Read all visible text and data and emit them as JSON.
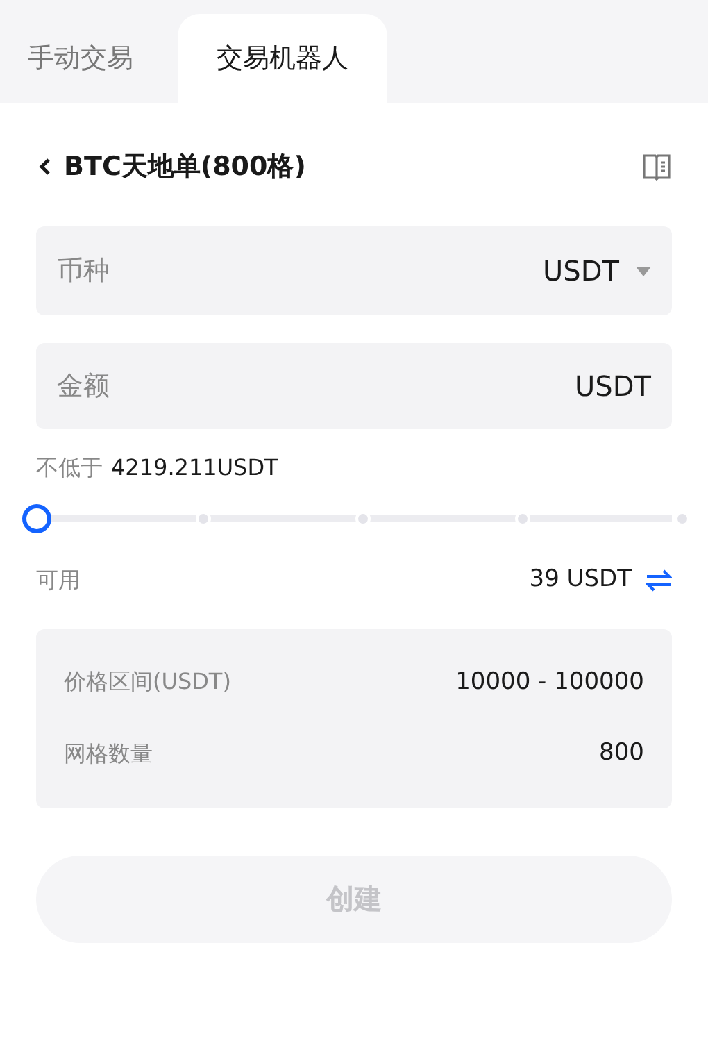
{
  "tabs": [
    {
      "label": "手动交易",
      "selected": false
    },
    {
      "label": "交易机器人",
      "selected": true
    }
  ],
  "header": {
    "title": "BTC天地单(800格)"
  },
  "currency_field": {
    "label": "币种",
    "value": "USDT"
  },
  "amount_field": {
    "label": "金额",
    "unit": "USDT"
  },
  "minimum": {
    "label": "不低于",
    "value": "4219.211USDT"
  },
  "slider": {
    "level": 0
  },
  "available": {
    "label": "可用",
    "value": "39 USDT"
  },
  "info_rows": [
    {
      "label": "价格区间(USDT)",
      "value": "10000 - 100000"
    },
    {
      "label": "网格数量",
      "value": "800"
    }
  ],
  "create_button": {
    "label": "创建",
    "disabled": true
  }
}
